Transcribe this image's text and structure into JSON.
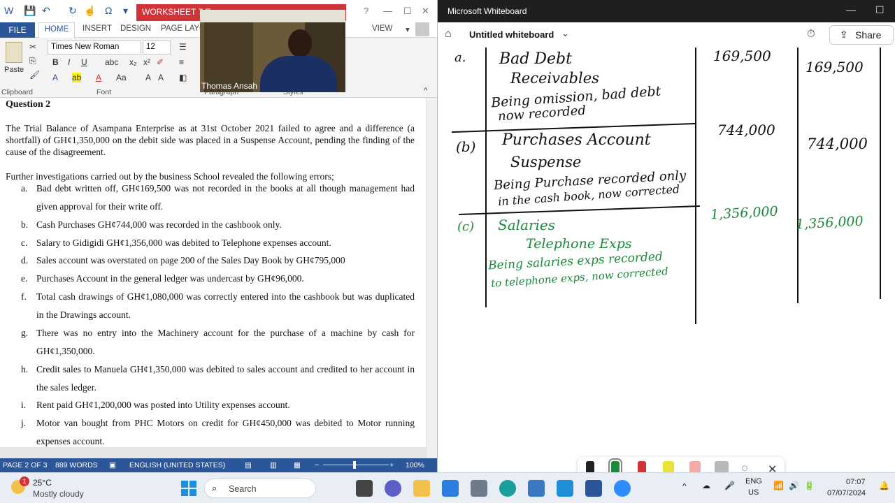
{
  "word": {
    "title": "WORKSHEET 7 Ex...",
    "tabs": [
      "FILE",
      "HOME",
      "INSERT",
      "DESIGN",
      "PAGE LAYO",
      "VIEW"
    ],
    "font_name": "Times New Roman",
    "font_size": "12",
    "groups": [
      "Clipboard",
      "Font",
      "Paragraph",
      "Styles"
    ],
    "paste_label": "Paste",
    "status": {
      "page": "PAGE 2 OF 3",
      "words": "889 WORDS",
      "language": "ENGLISH (UNITED STATES)",
      "zoom": "100%"
    },
    "doc": {
      "heading": "Question 2",
      "para1": "The Trial Balance of Asampana Enterprise as at 31st October 2021 failed to agree and a difference (a shortfall) of GH¢1,350,000 on the debit side was placed in a Suspense Account, pending the finding of the cause of the disagreement.",
      "para2": "Further investigations carried out by the business School revealed the following errors;",
      "items": [
        {
          "letter": "a.",
          "text": "Bad debt written off, GH¢169,500 was not recorded in the books at all though management had given approval for their write off."
        },
        {
          "letter": "b.",
          "text": "Cash Purchases GH¢744,000 was recorded in the cashbook only."
        },
        {
          "letter": "c.",
          "text": "Salary to Gidigidi GH¢1,356,000 was debited to Telephone expenses account."
        },
        {
          "letter": "d.",
          "text": "Sales account was overstated on page 200 of the Sales Day Book by GH¢795,000"
        },
        {
          "letter": "e.",
          "text": "Purchases Account in the general ledger was undercast by GH¢96,000."
        },
        {
          "letter": "f.",
          "text": "Total cash drawings of GH¢1,080,000 was correctly entered into the cashbook but was duplicated in the Drawings account."
        },
        {
          "letter": "g.",
          "text": "There was no entry into the Machinery account for the purchase of a machine by cash for GH¢1,350,000."
        },
        {
          "letter": "h.",
          "text": "Credit sales to Manuela GH¢1,350,000 was debited to sales account and credited to her account in the sales ledger."
        },
        {
          "letter": "i.",
          "text": "Rent paid GH¢1,200,000 was posted into Utility expenses account."
        },
        {
          "letter": "j.",
          "text": "Motor van bought from PHC Motors on credit for GH¢450,000 was debited to Motor running expenses account."
        }
      ]
    }
  },
  "video": {
    "name": "Thomas Ansah"
  },
  "whiteboard": {
    "app_title": "Microsoft Whiteboard",
    "board_title": "Untitled whiteboard",
    "share_label": "Share",
    "entries": {
      "a_label": "a.",
      "a_line1": "Bad Debt",
      "a_line2": "Receivables",
      "a_line3": "Being omission, bad debt",
      "a_line4": "now recorded",
      "a_dr": "169,500",
      "a_cr": "169,500",
      "b_label": "(b)",
      "b_line1": "Purchases Account",
      "b_line2": "Suspense",
      "b_line3": "Being Purchase recorded only",
      "b_line4": "in the cash book, now corrected",
      "b_dr": "744,000",
      "b_cr": "744,000",
      "c_label": "(c)",
      "c_line1": "Salaries",
      "c_line2": "Telephone Exps",
      "c_line3": "Being salaries exps recorded",
      "c_line4": "to telephone exps, now corrected",
      "c_dr": "1,356,000",
      "c_cr": "1,356,000"
    },
    "pen_colors": [
      "#222222",
      "#1c8a3c",
      "#d13438",
      "#e8e33a",
      "#f2a9a9",
      "#b8b8b8"
    ]
  },
  "taskbar": {
    "weather_temp": "25°C",
    "weather_desc": "Mostly cloudy",
    "weather_badge": "1",
    "search_placeholder": "Search",
    "lang1": "ENG",
    "lang2": "US",
    "time": "07:07",
    "date": "07/07/2024"
  }
}
